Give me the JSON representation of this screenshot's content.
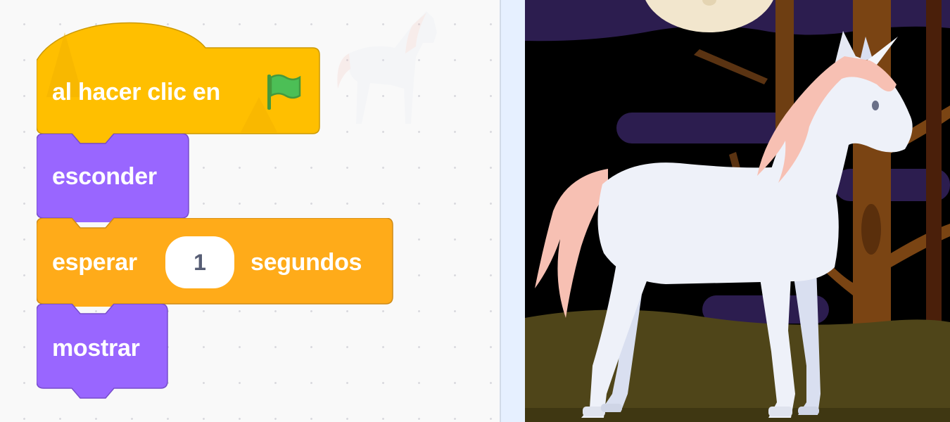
{
  "script": {
    "hat_block": {
      "label": "al hacer clic en",
      "icon": "green-flag-icon",
      "color": "#ffbf00"
    },
    "hide_block": {
      "label": "esconder",
      "color": "#9966ff"
    },
    "wait_block": {
      "label_before": "esperar",
      "input_value": "1",
      "label_after": "segundos",
      "color": "#ffab19"
    },
    "show_block": {
      "label": "mostrar",
      "color": "#9966ff"
    }
  },
  "stage": {
    "sprite": "unicorn",
    "backdrop": "night-forest"
  },
  "colors": {
    "code_background": "#f9f9f9",
    "flag_green": "#4cbf56",
    "sky": "#000000",
    "clouds": "#2c1d4f",
    "ground": "#4f4519",
    "unicorn_body": "#eef1f9",
    "unicorn_mane": "#f7c0b3",
    "tree_trunk": "#7a4413"
  }
}
